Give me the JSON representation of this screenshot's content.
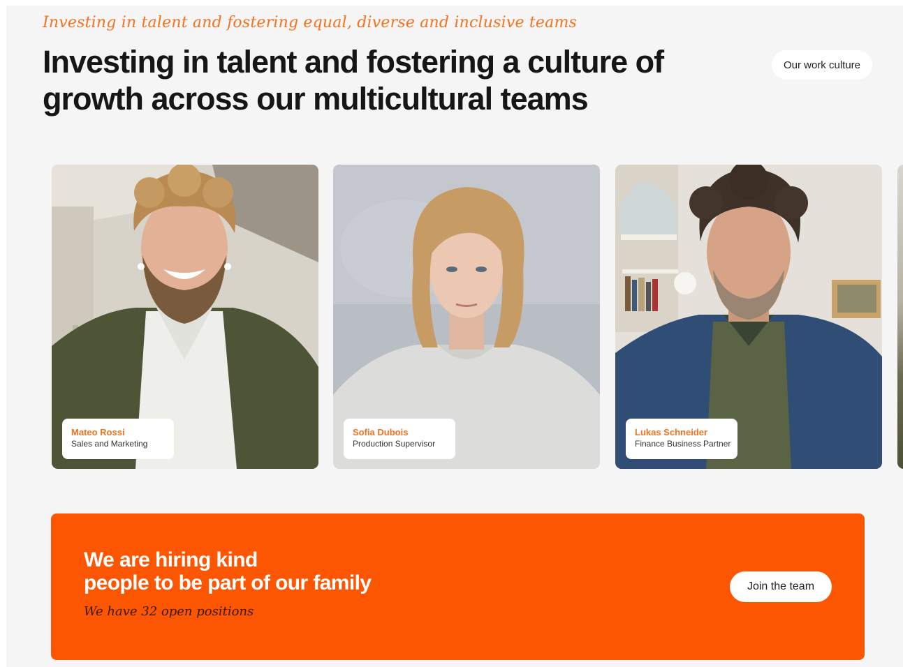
{
  "header": {
    "eyebrow": "Investing in talent and fostering equal, diverse and inclusive teams",
    "headline": "Investing in talent and fostering a culture of growth across our multicultural teams",
    "culture_button": "Our work culture"
  },
  "team": [
    {
      "name": "Mateo Rossi",
      "role": "Sales and Marketing"
    },
    {
      "name": "Sofia Dubois",
      "role": "Production Supervisor"
    },
    {
      "name": "Lukas Schneider",
      "role": "Finance Business Partner"
    }
  ],
  "hiring": {
    "title_line1": "We are hiring kind",
    "title_line2": "people to be part of our family",
    "subtitle": "We have 32 open positions",
    "button": "Join the team"
  },
  "colors": {
    "accent": "#f4721f",
    "banner": "#fc5603",
    "background": "#f5f5f5"
  }
}
